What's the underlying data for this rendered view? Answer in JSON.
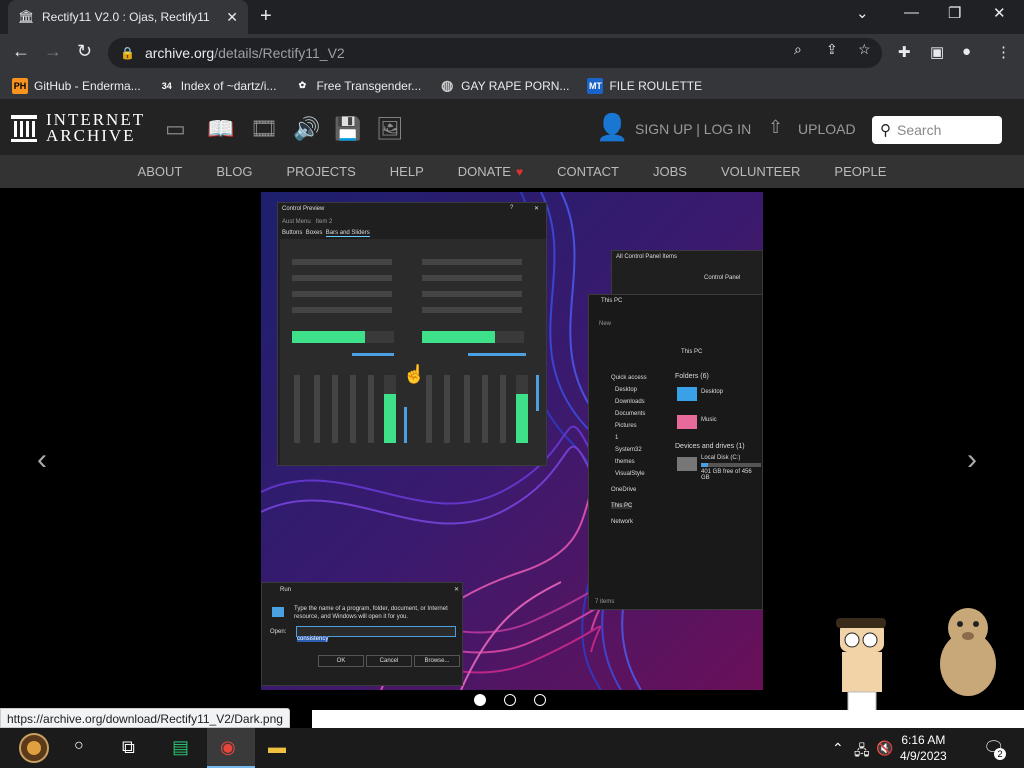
{
  "tab": {
    "title": "Rectify11 V2.0 : Ojas, Rectify11",
    "favicon": "archive-icon"
  },
  "omnibox": {
    "url_host": "archive.org",
    "url_path": "/details/Rectify11_V2"
  },
  "bookmarks": [
    {
      "label": "GitHub - Enderma...",
      "icon": "PH",
      "color": "#f7931e"
    },
    {
      "label": "Index of ~dartz/i...",
      "icon": "34",
      "color": "#555"
    },
    {
      "label": "Free Transgender...",
      "icon": "✿",
      "color": "#666"
    },
    {
      "label": "GAY RAPE PORN...",
      "icon": "◍",
      "color": "#666"
    },
    {
      "label": "FILE ROULETTE",
      "icon": "MT",
      "color": "#1a63c9"
    }
  ],
  "ia": {
    "logo_line1": "INTERNET",
    "logo_line2": "ARCHIVE",
    "sign": "SIGN UP | LOG IN",
    "upload": "UPLOAD",
    "search_placeholder": "Search",
    "nav": [
      "ABOUT",
      "BLOG",
      "PROJECTS",
      "HELP",
      "DONATE",
      "CONTACT",
      "JOBS",
      "VOLUNTEER",
      "PEOPLE"
    ]
  },
  "screenshot": {
    "control_preview_title": "Control Preview",
    "tabs": [
      "Buttons",
      "Boxes",
      "Bars and Sliders"
    ],
    "menu": [
      "Aust Menu",
      "Item 2"
    ],
    "explorer_title": "This PC",
    "address": "This PC",
    "control_panel_title": "All Control Panel Items",
    "control_panel_path": "Control Panel",
    "quick_access": "Quick access",
    "nav_items": [
      "Desktop",
      "Downloads",
      "Documents",
      "Pictures",
      "1",
      "System32",
      "themes",
      "VisualStyle",
      "OneDrive",
      "This PC",
      "Network"
    ],
    "folders_header": "Folders (6)",
    "folders": [
      "Desktop",
      "Music"
    ],
    "drives_header": "Devices and drives (1)",
    "drive_name": "Local Disk (C:)",
    "drive_free": "401 GB free of 456 GB",
    "items_count": "7 items",
    "run_title": "Run",
    "run_desc": "Type the name of a program, folder, document, or Internet resource, and Windows will open it for you.",
    "run_open": "Open:",
    "run_value": "consistency",
    "run_ok": "OK",
    "run_cancel": "Cancel",
    "run_browse": "Browse...",
    "new_label": "New"
  },
  "status_url": "https://archive.org/download/Rectify11_V2/Dark.png",
  "clock": {
    "time": "6:16 AM",
    "date": "4/9/2023"
  },
  "notifications": "2",
  "carousel": {
    "active": 0,
    "count": 3
  }
}
